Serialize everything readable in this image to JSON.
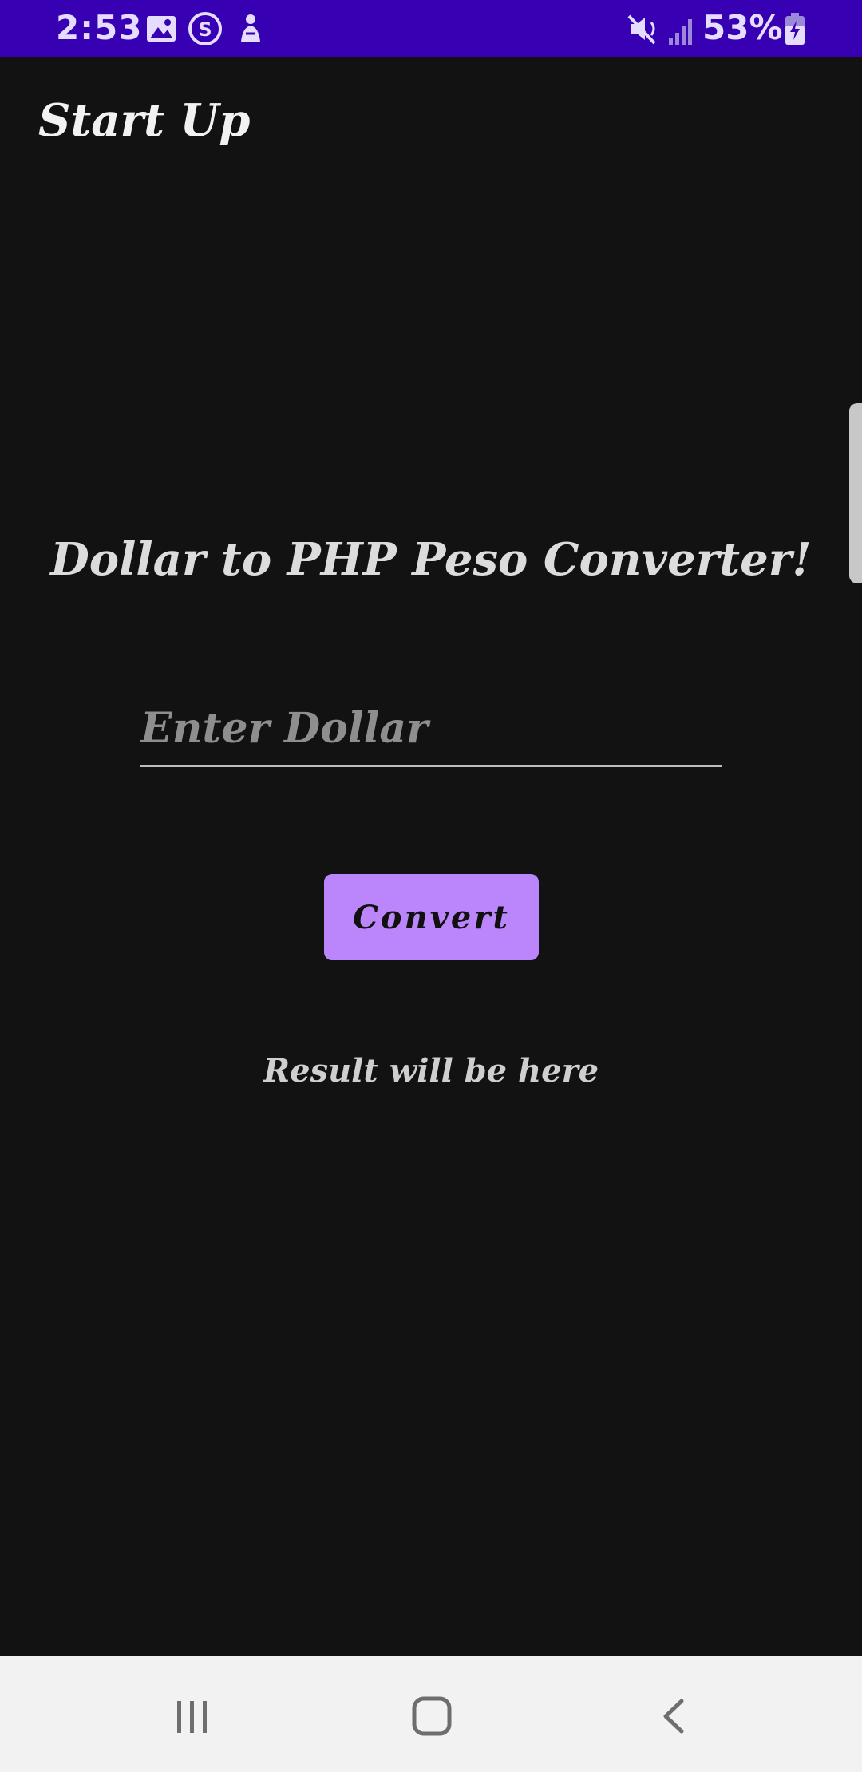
{
  "status_bar": {
    "time": "2:53",
    "battery": "53%",
    "background_color": "#3700b3",
    "icons": [
      "image-icon",
      "s-app-icon",
      "notification-app-icon",
      "mute-icon",
      "signal-icon",
      "battery-charging-icon"
    ]
  },
  "app_bar": {
    "title": "Start Up"
  },
  "main": {
    "heading": "Dollar to PHP Peso Converter!",
    "input_placeholder": "Enter Dollar",
    "input_value": "",
    "convert_label": "Convert",
    "result_text": "Result will be here"
  },
  "colors": {
    "background": "#121212",
    "accent": "#bb86fc",
    "status_bar": "#3700b3",
    "nav_bar": "#f2f2f2"
  },
  "nav_bar": {
    "icons": [
      "recent-apps-icon",
      "home-icon",
      "back-icon"
    ]
  }
}
